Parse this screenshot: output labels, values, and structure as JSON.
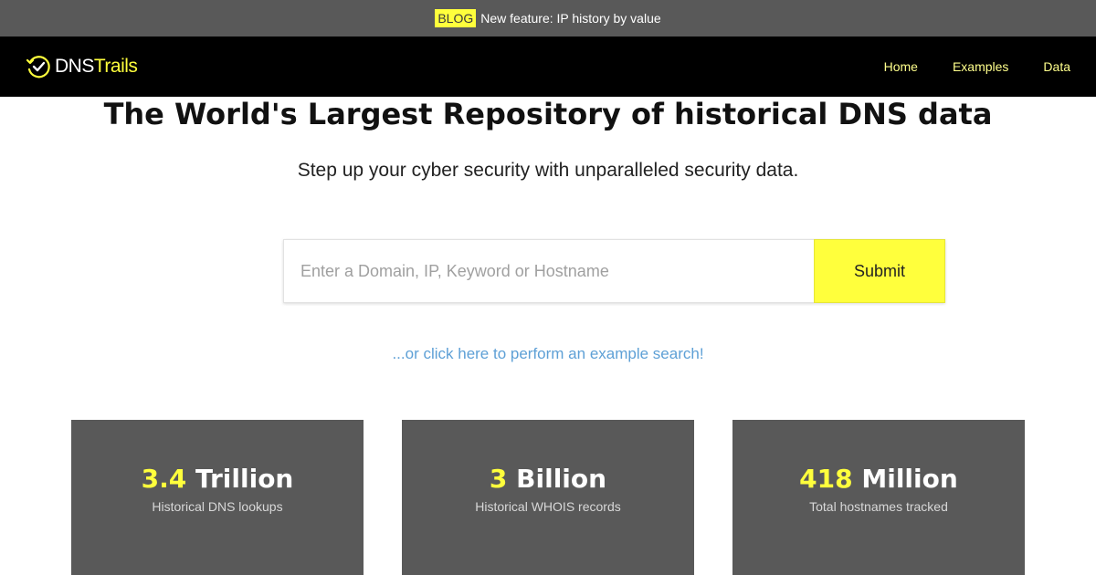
{
  "announcement": {
    "tag": "BLOG",
    "message": "New feature: IP history by value"
  },
  "brand": {
    "name_part1": "DNS",
    "name_part2": "Trails",
    "icon": "clock-check-icon"
  },
  "nav": {
    "links": [
      "Home",
      "Examples",
      "Data"
    ]
  },
  "hero": {
    "title": "The World's Largest Repository of historical DNS data",
    "subtitle": "Step up your cyber security with unparalleled security data."
  },
  "search": {
    "placeholder": "Enter a Domain, IP, Keyword or Hostname",
    "value": "",
    "submit_label": "Submit"
  },
  "example_link": "...or click here to perform an example search!",
  "stats": [
    {
      "number": "3.4",
      "unit": "Trillion",
      "label": "Historical DNS lookups"
    },
    {
      "number": "3",
      "unit": "Billion",
      "label": "Historical WHOIS records"
    },
    {
      "number": "418",
      "unit": "Million",
      "label": "Total hostnames tracked"
    }
  ],
  "colors": {
    "accent": "#ffff3c",
    "nav_bg": "#000000",
    "announce_bg": "#595959",
    "card_bg": "#595959",
    "link": "#5ea0d6"
  }
}
